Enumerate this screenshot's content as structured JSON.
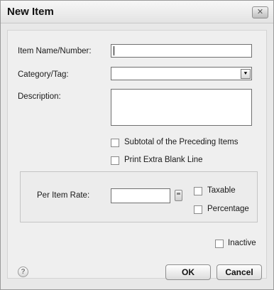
{
  "dialog": {
    "title": "New Item",
    "close_glyph": "✕"
  },
  "fields": {
    "item_name_label": "Item Name/Number:",
    "item_name_value": "",
    "category_label": "Category/Tag:",
    "category_value": "",
    "description_label": "Description:",
    "description_value": "",
    "rate_label": "Per Item Rate:",
    "rate_value": ""
  },
  "options": {
    "subtotal_label": "Subtotal of the Preceding Items",
    "blank_line_label": "Print Extra Blank Line",
    "taxable_label": "Taxable",
    "percentage_label": "Percentage",
    "inactive_label": "Inactive"
  },
  "buttons": {
    "ok_label": "OK",
    "cancel_label": "Cancel",
    "help_glyph": "?"
  },
  "icons": {
    "dropdown_glyph": "⯆",
    "calculator": "calculator-icon"
  }
}
